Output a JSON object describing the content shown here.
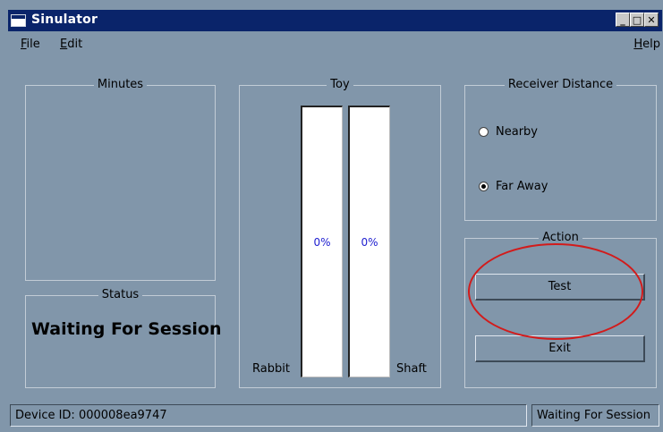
{
  "window": {
    "title": "Sinulator"
  },
  "menu": {
    "file": "File",
    "edit": "Edit",
    "help": "Help"
  },
  "groups": {
    "minutes": "Minutes",
    "status": "Status",
    "toy": "Toy",
    "receiver": "Receiver Distance",
    "action": "Action"
  },
  "toy": {
    "rabbit_label": "Rabbit",
    "shaft_label": "Shaft",
    "rabbit_percent": "0%",
    "shaft_percent": "0%",
    "rabbit_level": 0,
    "shaft_level": 0
  },
  "receiver": {
    "nearby": "Nearby",
    "far_away": "Far Away",
    "selected": "far_away"
  },
  "action": {
    "test": "Test",
    "exit": "Exit"
  },
  "status": {
    "message": "Waiting For Session"
  },
  "statusbar": {
    "device": "Device ID: 000008ea9747",
    "state": "Waiting For Session"
  },
  "colors": {
    "annotation": "#d21b1b",
    "percent_text": "#2020d0"
  }
}
